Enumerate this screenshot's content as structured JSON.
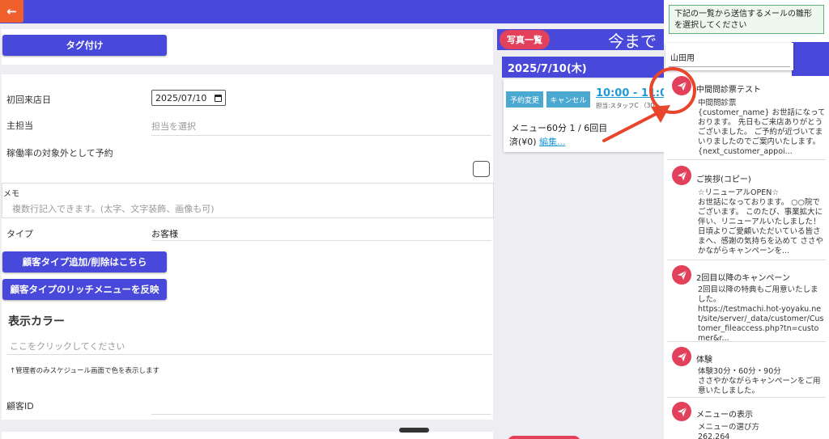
{
  "header": {
    "back_icon": "arrow-left-icon",
    "accent": "#4849db",
    "back_color": "#f0602c"
  },
  "form": {
    "tag_button": "タグ付け",
    "first_visit_label": "初回来店日",
    "first_visit_value": "2025/07/10",
    "main_staff_label": "主担当",
    "main_staff_placeholder": "担当を選択",
    "exclude_label": "稼働率の対象外として予約",
    "memo_label": "メモ",
    "memo_placeholder": "複数行記入できます。(太字、文字装飾、画像も可)",
    "type_label": "タイプ",
    "type_value": "お客様",
    "customer_type_button": "顧客タイプ追加/削除はこちら",
    "rich_menu_button": "顧客タイプのリッチメニューを反映",
    "display_color_title": "表示カラー",
    "display_color_placeholder": "ここをクリックしてください",
    "display_color_note": "↑管理者のみスケジュール画面で色を表示します",
    "customer_id_label": "顧客ID"
  },
  "calendar": {
    "photo_button": "写真一覧",
    "header_text": "今まで",
    "date": "2025/7/10(木)",
    "appointment": {
      "change_button": "予約変更",
      "cancel_button": "キャンセル",
      "time": "10:00 - 11:00",
      "staff": "担当:スタッフC （30",
      "menu": "メニュー60分 1 / 6回目",
      "paid": "済(¥0)",
      "edit_link": "編集..."
    }
  },
  "template_panel": {
    "instruction": "下記の一覧から送信するメールの雛形を選択してください",
    "recipient": "山田用",
    "templates": [
      {
        "title": "中間問診票テスト",
        "body": "中間問診票\n{customer_name} お世話になっております。 先日もご来店ありがとうございました。 ご予約が近づいてまいりましたのでご案内いたします。\n{next_customer_appoi..."
      },
      {
        "title": "ご挨拶(コピー)",
        "body": "☆リニューアルOPEN☆\nお世話になっております。 ○○院でございます。 このたび、事業拡大に伴い、リニューアルいたしました！ 日頃よりご愛顧いただいている皆さまへ、感謝の気持ちを込めて ささやかながらキャンペーンを..."
      },
      {
        "title": "2回目以降のキャンペーン",
        "body": "2回目以降の特典もご用意いたしました。\nhttps://testmachi.hot-yoyaku.net/site/server/_data/customer/Customer_fileaccess.php?tn=customer&r..."
      },
      {
        "title": "体験",
        "body": "体験30分・60分・90分\nささやかながらキャンペーンをご用意いたしました。"
      },
      {
        "title": "メニューの表示",
        "body": "メニューの選び方\n262,264"
      }
    ],
    "send_icon": "paper-plane-icon",
    "send_color": "#e2405b"
  },
  "annotation": {
    "color": "#e8452c"
  }
}
